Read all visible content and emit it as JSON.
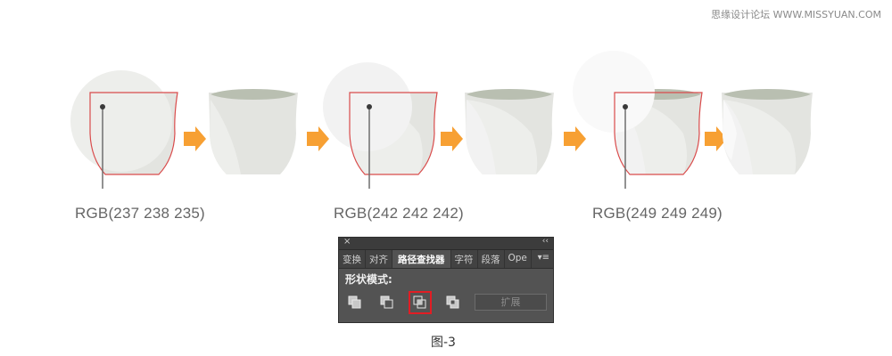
{
  "watermark": "思缘设计论坛 WWW.MISSYUAN.COM",
  "steps": [
    {
      "rgb_label": "RGB(237 238 235)",
      "circle_color": "#edeeeb"
    },
    {
      "rgb_label": "RGB(242 242 242)",
      "circle_color": "#f2f2f2"
    },
    {
      "rgb_label": "RGB(249 249 249)",
      "circle_color": "#f9f9f9"
    }
  ],
  "colors": {
    "cup_body": "#e3e4e0",
    "cup_rim": "#b9bfb1",
    "outline_red": "#d94b4b",
    "arrow_orange": "#f7a033"
  },
  "panel": {
    "close_icon": "×",
    "collapse_icon": "‹‹",
    "tabs": [
      "变换",
      "对齐",
      "路径查找器",
      "字符",
      "段落",
      "Ope"
    ],
    "active_tab_index": 2,
    "menu_icon": "▾≡",
    "section_label": "形状模式:",
    "shape_modes": [
      "unite-icon",
      "minus-front-icon",
      "intersect-icon",
      "exclude-icon"
    ],
    "selected_mode_index": 2,
    "expand_label": "扩展"
  },
  "caption": "图-3"
}
